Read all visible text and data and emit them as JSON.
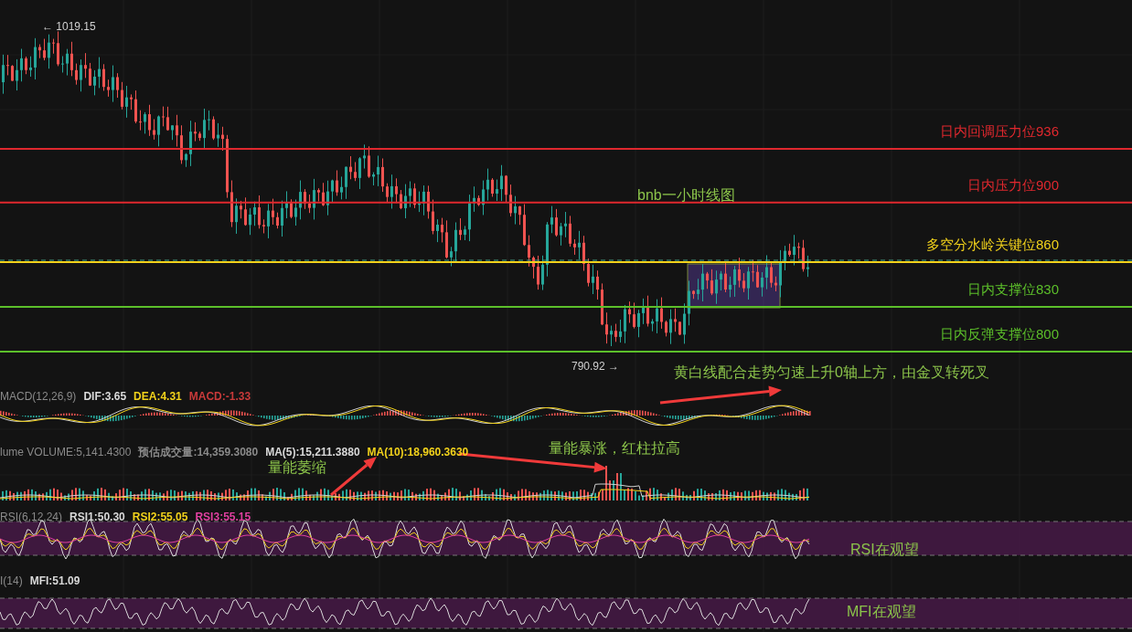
{
  "chart": {
    "title": "bnb一小时线图",
    "high_marker": "← 1019.15",
    "low_marker": "790.92 →",
    "levels": [
      {
        "label": "日内回调压力位936",
        "color": "#e0282e"
      },
      {
        "label": "日内压力位900",
        "color": "#e0282e"
      },
      {
        "label": "多空分水岭关键位860",
        "color": "#f2d21b"
      },
      {
        "label": "日内支撑位830",
        "color": "#5cbf2a"
      },
      {
        "label": "日内反弹支撑位800",
        "color": "#5cbf2a"
      }
    ],
    "annotations": [
      "黄白线配合走势匀速上升0轴上方，由金叉转死叉",
      "量能暴涨，红柱拉高",
      "量能萎缩",
      "RSI在观望",
      "MFI在观望"
    ]
  },
  "macd": {
    "items": [
      {
        "text": "MACD(12,26,9)",
        "color": "#8a8a8a"
      },
      {
        "text": "DIF:3.65",
        "color": "#d9d9d9"
      },
      {
        "text": "DEA:4.31",
        "color": "#f2d21b"
      },
      {
        "text": "MACD:-1.33",
        "color": "#c83a3a"
      }
    ]
  },
  "volume": {
    "items": [
      {
        "text": "lume VOLUME:5,141.4300",
        "color": "#8a8a8a"
      },
      {
        "text": "预估成交量:14,359.3080",
        "color": "#8a8a8a"
      },
      {
        "text": "MA(5):15,211.3880",
        "color": "#d9d9d9"
      },
      {
        "text": "MA(10):18,960.3630",
        "color": "#f2d21b"
      }
    ]
  },
  "rsi": {
    "items": [
      {
        "text": "RSI(6,12,24)",
        "color": "#8a8a8a"
      },
      {
        "text": "RSI1:50.30",
        "color": "#d9d9d9"
      },
      {
        "text": "RSI2:55.05",
        "color": "#f2d21b"
      },
      {
        "text": "RSI3:55.15",
        "color": "#e040a0"
      }
    ]
  },
  "mfi": {
    "items": [
      {
        "text": "I(14)",
        "color": "#8a8a8a"
      },
      {
        "text": "MFI:51.09",
        "color": "#d9d9d9"
      }
    ]
  }
}
